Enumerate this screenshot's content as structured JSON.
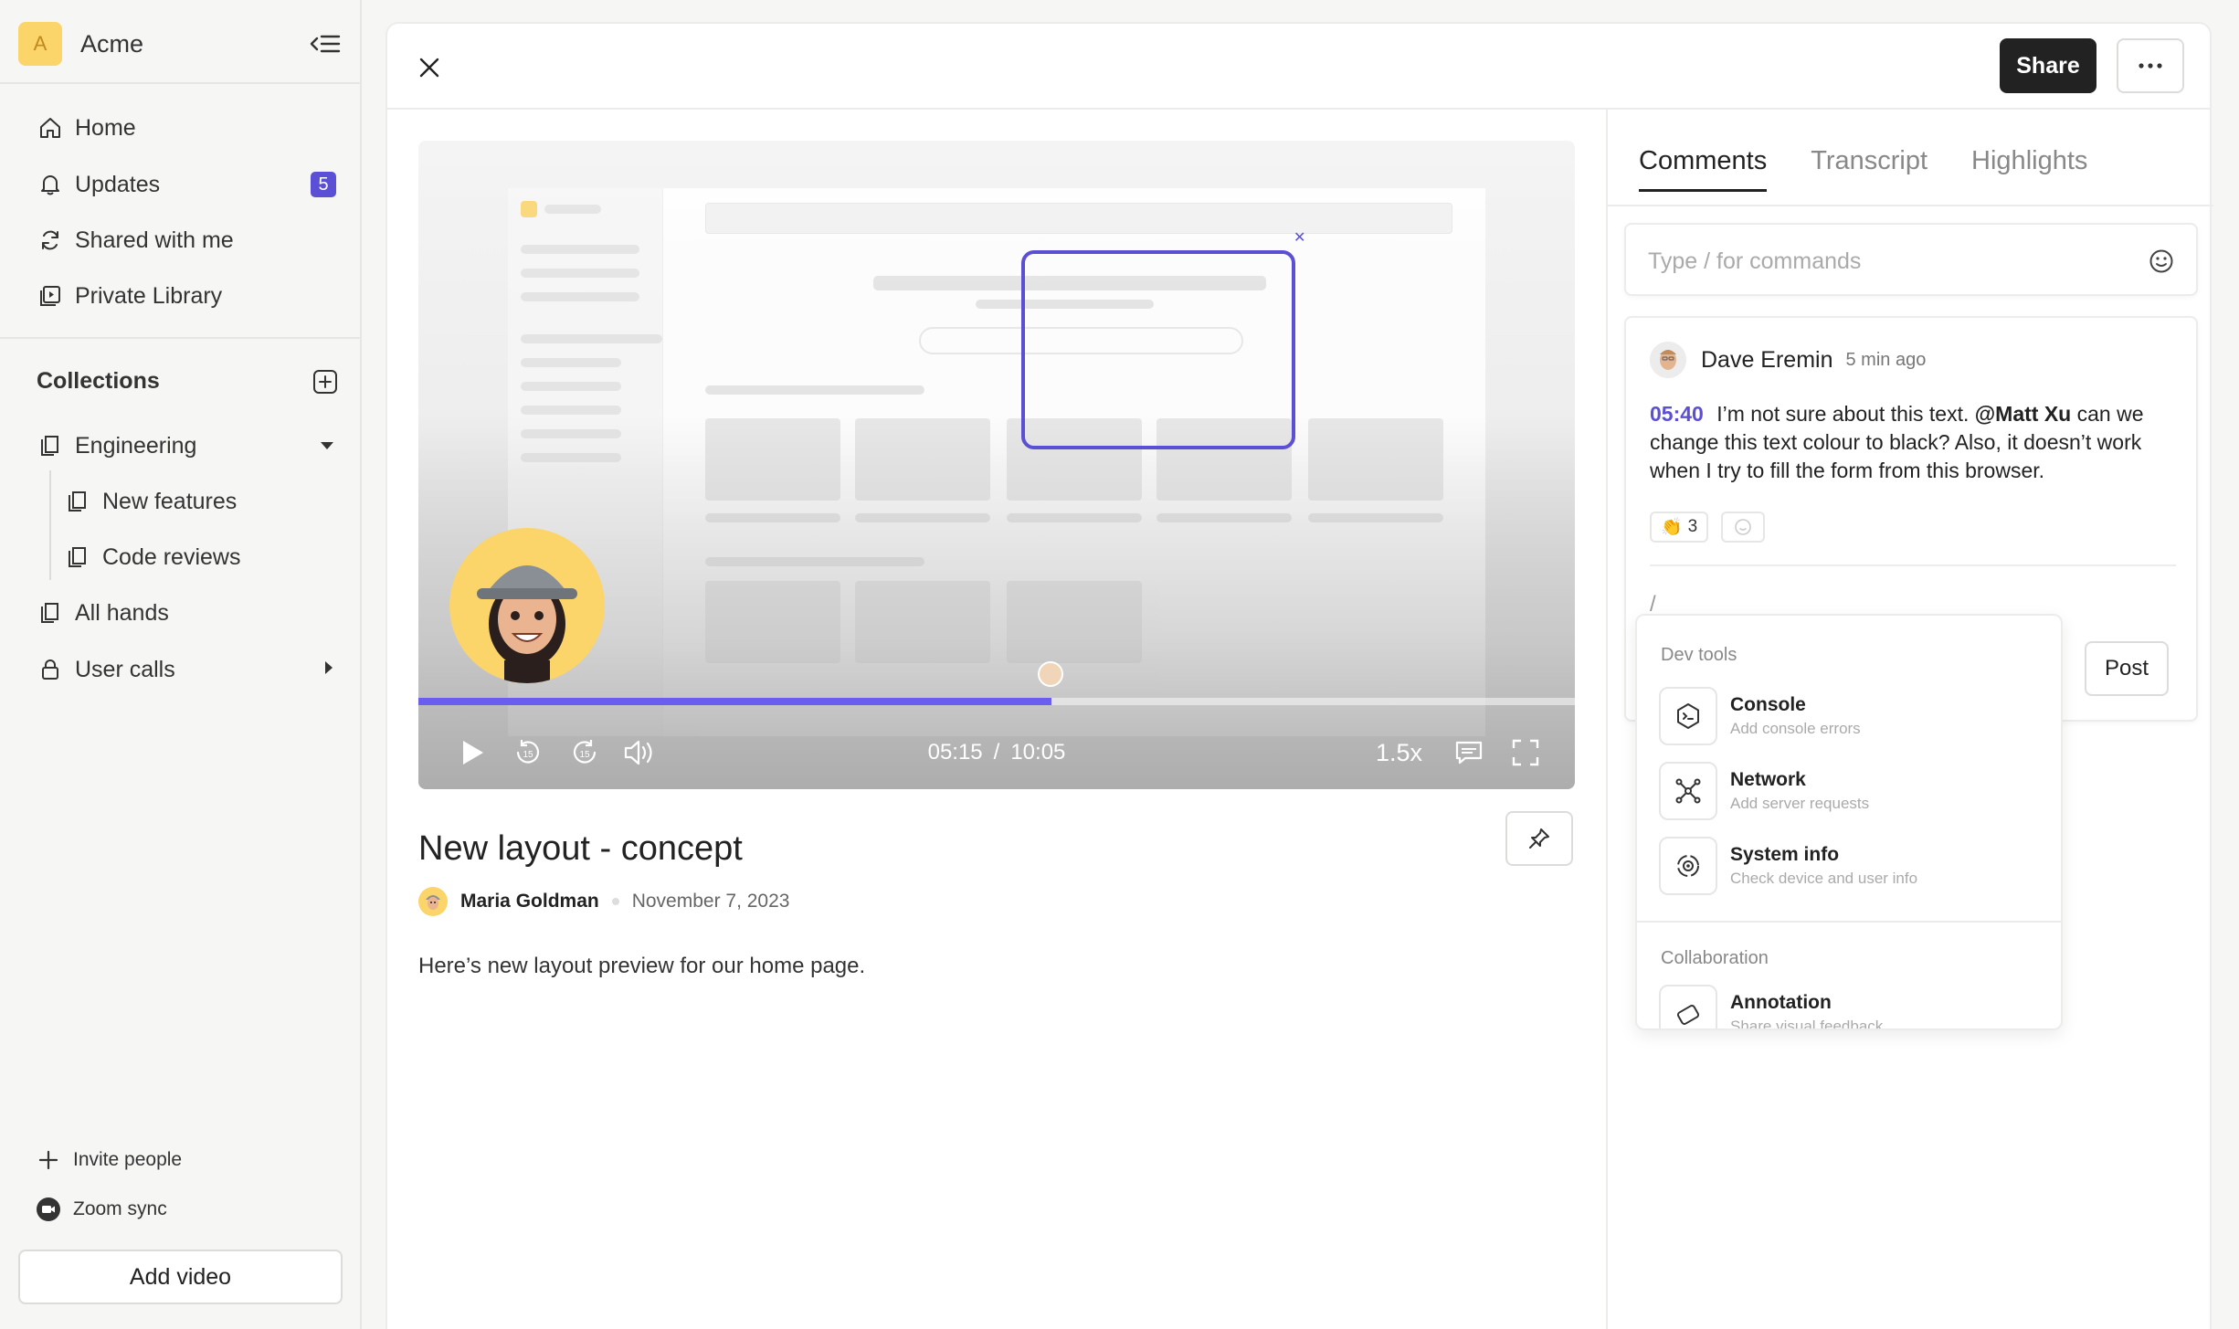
{
  "workspace": {
    "initial": "A",
    "name": "Acme"
  },
  "nav": {
    "home": "Home",
    "updates": "Updates",
    "updates_count": "5",
    "shared": "Shared with me",
    "library": "Private Library"
  },
  "collections": {
    "title": "Collections",
    "engineering": "Engineering",
    "new_features": "New features",
    "code_reviews": "Code reviews",
    "all_hands": "All hands",
    "user_calls": "User calls"
  },
  "footer": {
    "invite": "Invite people",
    "zoom": "Zoom sync",
    "add_video": "Add video"
  },
  "header": {
    "share": "Share"
  },
  "player": {
    "current_time": "05:15",
    "separator": "/",
    "duration": "10:05",
    "speed": "1.5x",
    "progress": 0.547
  },
  "video": {
    "title": "New layout - concept",
    "author": "Maria Goldman",
    "date": "November 7, 2023",
    "description": "Here’s new layout preview for our home page."
  },
  "panel": {
    "tabs": [
      "Comments",
      "Transcript",
      "Highlights"
    ],
    "input_placeholder": "Type / for commands"
  },
  "comment": {
    "author": "Dave Eremin",
    "time": "5 min ago",
    "timestamp": "05:40",
    "text_before": "I’m not sure about this text.",
    "mention": "@Matt Xu",
    "text_after": "can we change this text colour to black? Also, it doesn’t work when I try to fill the form from this browser.",
    "reaction_emoji": "👏",
    "reaction_count": "3",
    "reply_value": "/",
    "post_label": "Post"
  },
  "commands": {
    "group1": "Dev tools",
    "group2": "Collaboration",
    "items": [
      {
        "title": "Console",
        "subtitle": "Add console errors",
        "icon": "terminal-icon"
      },
      {
        "title": "Network",
        "subtitle": "Add server requests",
        "icon": "network-icon"
      },
      {
        "title": "System info",
        "subtitle": "Check device and user info",
        "icon": "system-info-icon"
      },
      {
        "title": "Annotation",
        "subtitle": "Share visual feedback",
        "icon": "annotation-icon"
      }
    ]
  },
  "colors": {
    "accent": "#5b4fd6",
    "avatar_bg": "#fbd46a",
    "dark_button": "#222222"
  }
}
